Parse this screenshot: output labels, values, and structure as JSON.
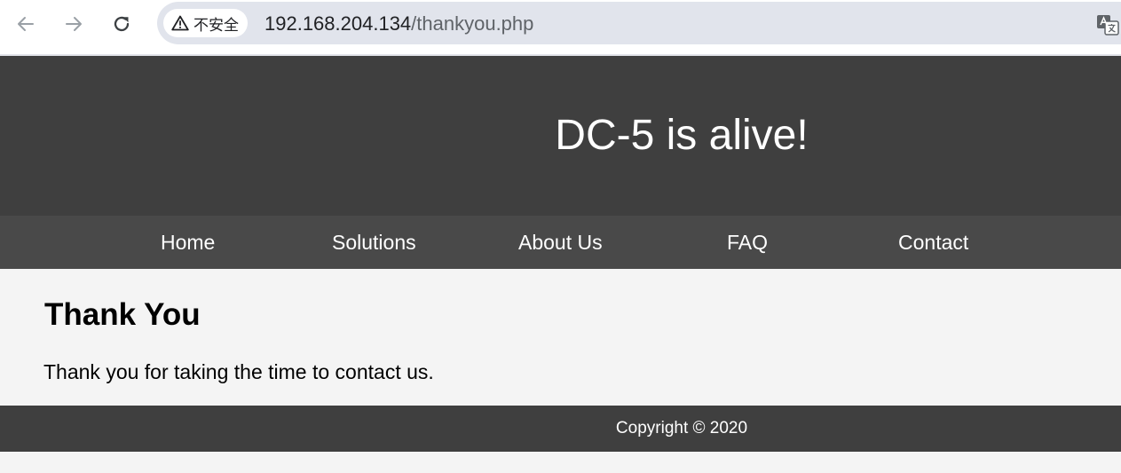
{
  "browser": {
    "security_label": "不安全",
    "url_host": "192.168.204.134",
    "url_path": "/thankyou.php"
  },
  "site": {
    "title": "DC-5 is alive!",
    "nav": [
      "Home",
      "Solutions",
      "About Us",
      "FAQ",
      "Contact"
    ],
    "heading": "Thank You",
    "message": "Thank you for taking the time to contact us.",
    "footer": "Copyright © 2020"
  },
  "colors": {
    "header_bg": "#3f3f3f",
    "nav_bg": "#494949",
    "content_bg": "#f4f4f4",
    "footer_bg": "#3f3f3f",
    "omnibox_bg": "#e1e4ec"
  },
  "icons": {
    "back": "arrow-left-icon",
    "forward": "arrow-right-icon",
    "reload": "reload-icon",
    "warning": "warning-triangle-icon",
    "translate": "translate-icon"
  }
}
